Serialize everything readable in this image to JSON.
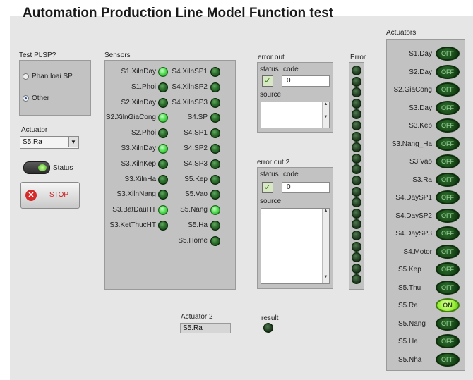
{
  "window": {
    "title": "Automation Production Line Model Function test"
  },
  "test_plsp": {
    "label": "Test PLSP?",
    "options": [
      {
        "label": "Phan loai SP",
        "selected": false
      },
      {
        "label": "Other",
        "selected": true
      }
    ]
  },
  "actuator_select": {
    "label": "Actuator",
    "value": "S5.Ra"
  },
  "status_toggle": {
    "label": "Status",
    "state": "on"
  },
  "stop_button": {
    "label": "STOP"
  },
  "sensors": {
    "label": "Sensors",
    "col1": [
      {
        "label": "S1.XilnDay",
        "state": "on"
      },
      {
        "label": "S1.Phoi",
        "state": "off"
      },
      {
        "label": "S2.XilnDay",
        "state": "off"
      },
      {
        "label": "S2.XilnGiaCong",
        "state": "on"
      },
      {
        "label": "S2.Phoi",
        "state": "off"
      },
      {
        "label": "S3.XilnDay",
        "state": "on"
      },
      {
        "label": "S3.XilnKep",
        "state": "off"
      },
      {
        "label": "S3.XilnHa",
        "state": "off"
      },
      {
        "label": "S3.XilnNang",
        "state": "off"
      },
      {
        "label": "S3.BatDauHT",
        "state": "on"
      },
      {
        "label": "S3.KetThucHT",
        "state": "off"
      }
    ],
    "col2": [
      {
        "label": "S4.XilnSP1",
        "state": "off"
      },
      {
        "label": "S4.XilnSP2",
        "state": "off"
      },
      {
        "label": "S4.XilnSP3",
        "state": "off"
      },
      {
        "label": "S4.SP",
        "state": "off"
      },
      {
        "label": "S4.SP1",
        "state": "off"
      },
      {
        "label": "S4.SP2",
        "state": "off"
      },
      {
        "label": "S4.SP3",
        "state": "off"
      },
      {
        "label": "S5.Kep",
        "state": "off"
      },
      {
        "label": "S5.Vao",
        "state": "off"
      },
      {
        "label": "S5.Nang",
        "state": "on"
      },
      {
        "label": "S5.Ha",
        "state": "off"
      },
      {
        "label": "S5.Home",
        "state": "off"
      }
    ]
  },
  "error_out": {
    "label": "error out",
    "status_label": "status",
    "code_label": "code",
    "code_value": "0",
    "source_label": "source",
    "check": "✓"
  },
  "error_out_2": {
    "label": "error out 2",
    "status_label": "status",
    "code_label": "code",
    "code_value": "0",
    "source_label": "source",
    "check": "✓"
  },
  "error_column": {
    "label": "Error",
    "count": 20
  },
  "actuator_2": {
    "label": "Actuator 2",
    "value": "S5.Ra"
  },
  "result": {
    "label": "result"
  },
  "actuators": {
    "label": "Actuators",
    "items": [
      {
        "label": "S1.Day",
        "state": "OFF"
      },
      {
        "label": "S2.Day",
        "state": "OFF"
      },
      {
        "label": "S2.GiaCong",
        "state": "OFF"
      },
      {
        "label": "S3.Day",
        "state": "OFF"
      },
      {
        "label": "S3.Kep",
        "state": "OFF"
      },
      {
        "label": "S3.Nang_Ha",
        "state": "OFF"
      },
      {
        "label": "S3.Vao",
        "state": "OFF"
      },
      {
        "label": "S3.Ra",
        "state": "OFF"
      },
      {
        "label": "S4.DaySP1",
        "state": "OFF"
      },
      {
        "label": "S4.DaySP2",
        "state": "OFF"
      },
      {
        "label": "S4.DaySP3",
        "state": "OFF"
      },
      {
        "label": "S4.Motor",
        "state": "OFF"
      },
      {
        "label": "S5.Kep",
        "state": "OFF"
      },
      {
        "label": "S5.Thu",
        "state": "OFF"
      },
      {
        "label": "S5.Ra",
        "state": "ON"
      },
      {
        "label": "S5.Nang",
        "state": "OFF"
      },
      {
        "label": "S5.Ha",
        "state": "OFF"
      },
      {
        "label": "S5.Nha",
        "state": "OFF"
      }
    ]
  }
}
